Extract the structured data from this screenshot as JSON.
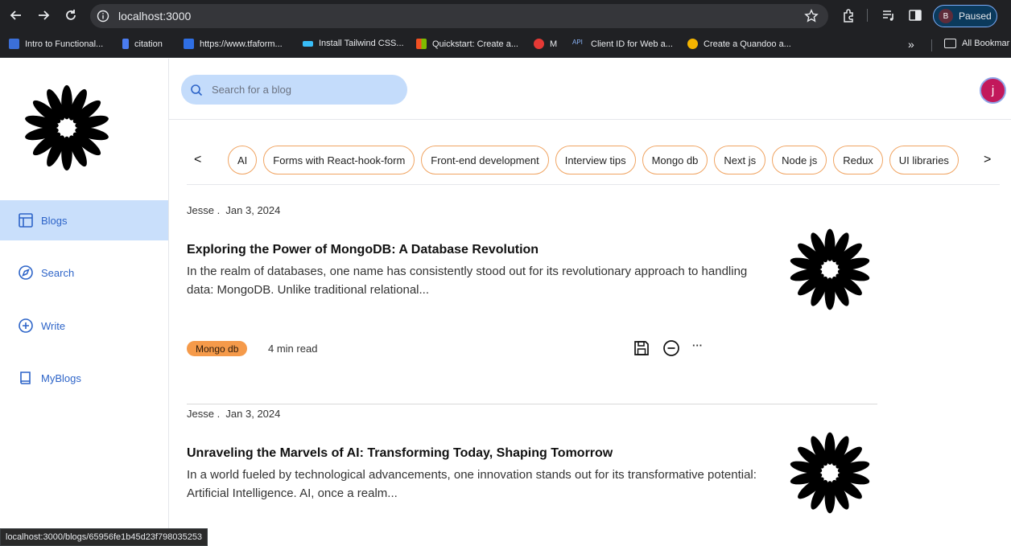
{
  "browser": {
    "url": "localhost:3000",
    "profile_initial": "B",
    "profile_label": "Paused",
    "bookmarks": [
      {
        "label": "Intro to Functional...",
        "icon": "bluetooth-like-icon",
        "color": "#3b6fd8"
      },
      {
        "label": "citation",
        "icon": "bookmark-icon",
        "color": "#4a7cf0"
      },
      {
        "label": "https://www.tfaform...",
        "icon": "f-logo-icon",
        "color": "#2f6fe4"
      },
      {
        "label": "Install Tailwind CSS...",
        "icon": "tailwind-icon",
        "color": "#38bdf8"
      },
      {
        "label": "Quickstart: Create a...",
        "icon": "microsoft-icon",
        "color": "#f25022"
      },
      {
        "label": "M",
        "icon": "record-icon",
        "color": "#e53935"
      },
      {
        "label": "Client ID for Web a...",
        "icon": "api-icon",
        "color": "#8ab4f8"
      },
      {
        "label": "Create a Quandoo a...",
        "icon": "quandoo-icon",
        "color": "#f4b400"
      }
    ],
    "bookmarks_more": "»",
    "all_bookmarks": "All Bookmar",
    "status_url": "localhost:3000/blogs/65956fe1b45d23f798035253"
  },
  "sidebar": {
    "items": [
      {
        "label": "Blogs",
        "icon": "layout-icon",
        "active": true
      },
      {
        "label": "Search",
        "icon": "compass-icon",
        "active": false
      },
      {
        "label": "Write",
        "icon": "plus-circle-icon",
        "active": false
      },
      {
        "label": "MyBlogs",
        "icon": "book-icon",
        "active": false
      }
    ]
  },
  "header": {
    "search_placeholder": "Search for a blog",
    "avatar_initial": "j"
  },
  "tags": {
    "prev": "<",
    "next": ">",
    "items": [
      "AI",
      "Forms with React-hook-form",
      "Front-end development",
      "Interview tips",
      "Mongo db",
      "Next js",
      "Node js",
      "Redux",
      "UI libraries"
    ]
  },
  "posts": [
    {
      "author": "Jesse .",
      "date": "Jan 3, 2024",
      "title": "Exploring the Power of MongoDB: A Database Revolution",
      "excerpt": "In the realm of databases, one name has consistently stood out for its revolutionary approach to handling data: MongoDB. Unlike traditional relational...",
      "tag": "Mongo db",
      "read_time": "4 min read",
      "more": "···"
    },
    {
      "author": "Jesse .",
      "date": "Jan 3, 2024",
      "title": "Unraveling the Marvels of AI: Transforming Today, Shaping Tomorrow",
      "excerpt": "In a world fueled by technological advancements, one innovation stands out for its transformative potential: Artificial Intelligence. AI, once a realm..."
    }
  ],
  "colors": {
    "accent": "#2d64c8",
    "active_nav": "#c9dffb",
    "tag_border": "#f0a462",
    "tag_pill": "#f59a4a",
    "avatar": "#c2185b"
  }
}
